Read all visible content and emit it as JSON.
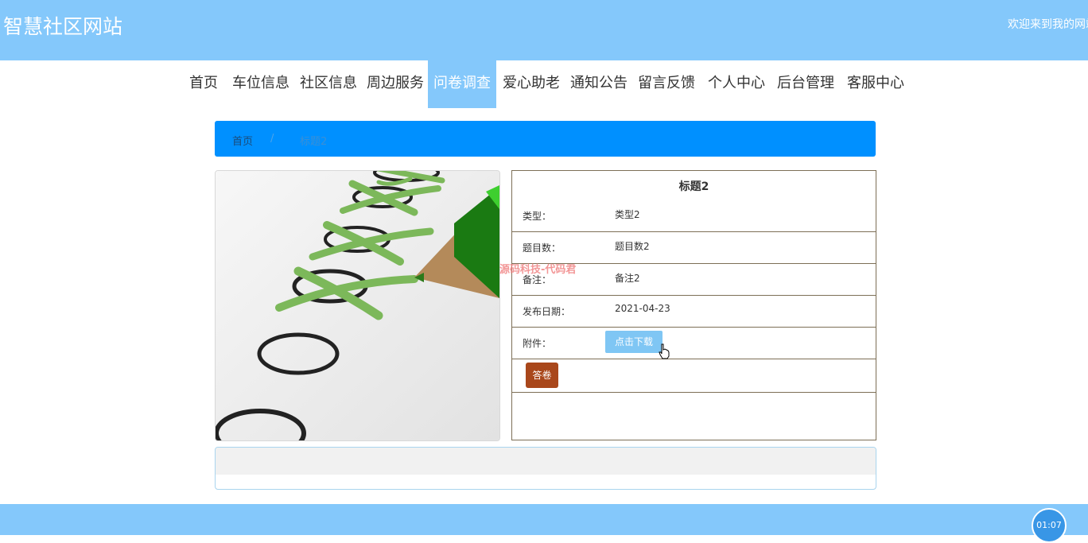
{
  "header": {
    "site_title": "智慧社区网站",
    "welcome": "欢迎来到我的网站"
  },
  "nav": {
    "items": [
      "首页",
      "车位信息",
      "社区信息",
      "周边服务",
      "问卷调查",
      "爱心助老",
      "通知公告",
      "留言反馈",
      "个人中心",
      "后台管理",
      "客服中心"
    ],
    "active_index": 4
  },
  "breadcrumb": {
    "home": "首页",
    "separator": "/",
    "current": "标题2"
  },
  "detail": {
    "title": "标题2",
    "rows": [
      {
        "label": "类型：",
        "value": "类型2"
      },
      {
        "label": "题目数：",
        "value": "题目数2"
      },
      {
        "label": "备注：",
        "value": "备注2"
      },
      {
        "label": "发布日期：",
        "value": "2021-04-23"
      },
      {
        "label": "附件：",
        "button": "点击下载"
      }
    ],
    "answer_button": "答卷"
  },
  "watermark": "源码科技-代码君",
  "timer": "01:07",
  "colors": {
    "header_bg": "#84c8fb",
    "breadcrumb_bg": "#0090ff",
    "download_button": "#7fc6f4",
    "answer_button": "#a9471b",
    "detail_border": "#7d6f56"
  }
}
